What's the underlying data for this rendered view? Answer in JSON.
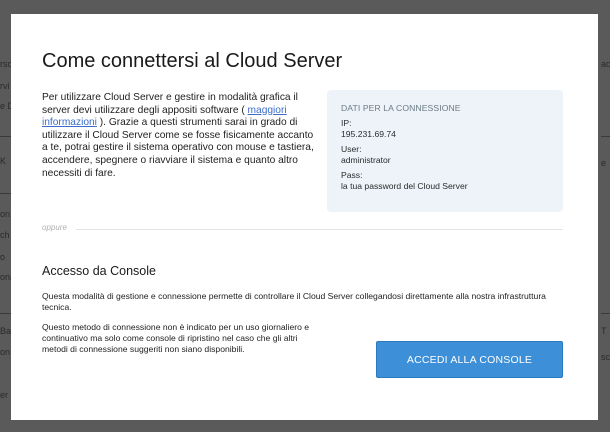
{
  "background_fragments": {
    "left": [
      "rso",
      "rvi",
      "e D",
      "",
      "",
      "",
      "K",
      "",
      "",
      "on",
      "ch",
      "o",
      "ona",
      "",
      "",
      "",
      "",
      "Ba",
      "on",
      "",
      "",
      "er"
    ],
    "right": [
      "ac",
      "",
      "",
      "",
      "",
      "",
      "e",
      "",
      "",
      "",
      "",
      "",
      "",
      "",
      "",
      "",
      "",
      "T",
      "sc"
    ]
  },
  "modal": {
    "title": "Come connettersi al Cloud Server",
    "intro": {
      "text_before_link": "Per utilizzare Cloud Server e gestire in modalità grafica il server devi utilizzare degli appositi software ( ",
      "link_text": "maggiori informazioni",
      "text_after_link": " ). Grazie a questi strumenti sarai in grado di utilizzare il Cloud Server come se fosse fisicamente accanto a te, potrai gestire il sistema operativo con mouse e tastiera, accendere, spegnere o riavviare il sistema e quanto altro necessiti di fare."
    },
    "connection_info": {
      "heading": "DATI PER LA CONNESSIONE",
      "ip_label": "IP:",
      "ip_value": "195.231.69.74",
      "user_label": "User:",
      "user_value": "administrator",
      "pass_label": "Pass:",
      "pass_value": "la tua password del Cloud Server"
    },
    "divider_text": "oppure",
    "console_section": {
      "title": "Accesso da Console",
      "description": "Questa modalità di gestione e connessione permette di controllare il Cloud Server collegandosi direttamente alla nostra infrastruttura tecnica.",
      "note": "Questo metodo di connessione non è indicato per un uso giornaliero e continuativo ma solo come console di ripristino nel caso che gli altri metodi di connessione suggeriti non siano disponibili.",
      "button_label": "ACCEDI ALLA CONSOLE"
    }
  },
  "colors": {
    "overlay": "#5a5a5a",
    "info_box": "#edf3f9",
    "button": "#3d8fd8",
    "link": "#3b6cc9"
  }
}
